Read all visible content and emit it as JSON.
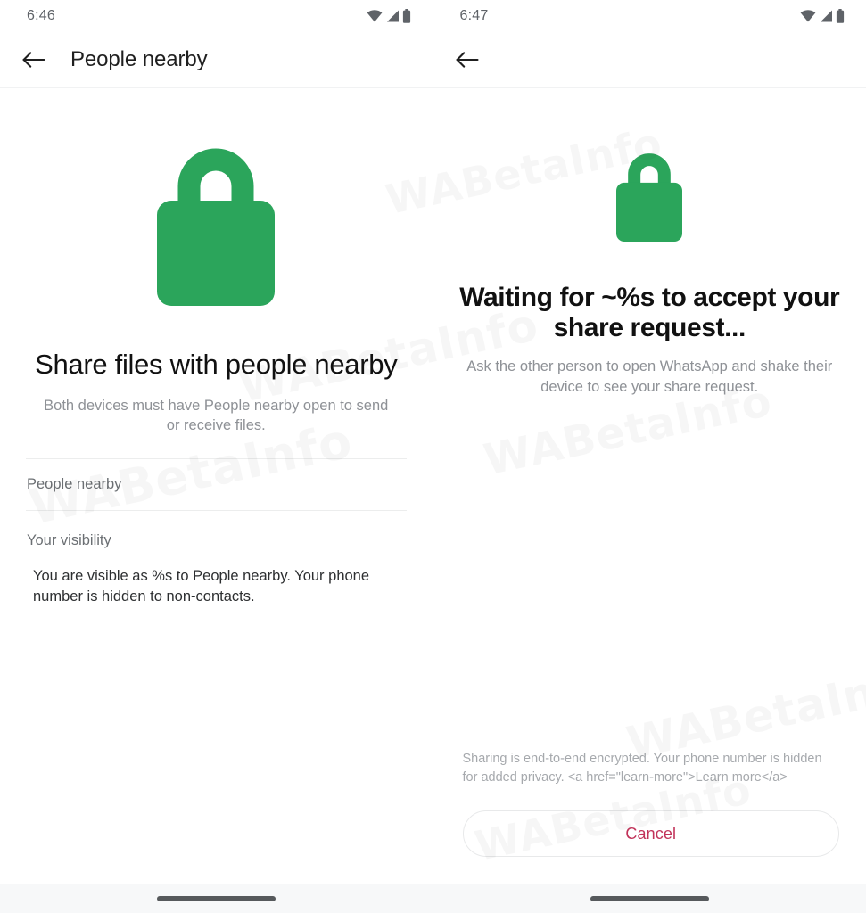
{
  "theme": {
    "lock_green": "#2ba55b",
    "cancel_red": "#c2335a",
    "title_color": "#111111",
    "muted_color": "#8e9196",
    "divider_color": "#eceded",
    "nav_pill_color": "#56595c"
  },
  "watermark": {
    "text": "WABetaInfo"
  },
  "left_screen": {
    "status_bar": {
      "time": "6:46",
      "icons": [
        "wifi-icon",
        "cellular-signal-icon",
        "battery-icon"
      ]
    },
    "app_bar": {
      "back_icon": "back-arrow-icon",
      "title": "People nearby"
    },
    "hero": {
      "icon": "lock-icon",
      "title": "Share files with people nearby",
      "subtitle": "Both devices must have People nearby open to send or receive files."
    },
    "list": {
      "rows": [
        {
          "label": "People nearby"
        }
      ]
    },
    "visibility_section": {
      "header": "Your visibility",
      "body": "You are visible as %s to People nearby. Your phone number is hidden to non-contacts."
    },
    "nav_bar": {
      "pill": "home-gesture-pill"
    }
  },
  "right_screen": {
    "status_bar": {
      "time": "6:47",
      "icons": [
        "wifi-icon",
        "cellular-signal-icon",
        "battery-icon"
      ]
    },
    "app_bar": {
      "back_icon": "back-arrow-icon",
      "title": ""
    },
    "hero": {
      "icon": "lock-icon",
      "title": "Waiting for ~%s to accept your share request...",
      "subtitle": "Ask the other person to open WhatsApp and shake their device to see your share request."
    },
    "footer": {
      "note": "Sharing is end-to-end encrypted. Your phone number is hidden for added privacy. <a href=\"learn-more\">Learn more</a>",
      "cancel_label": "Cancel"
    },
    "nav_bar": {
      "pill": "home-gesture-pill"
    }
  }
}
